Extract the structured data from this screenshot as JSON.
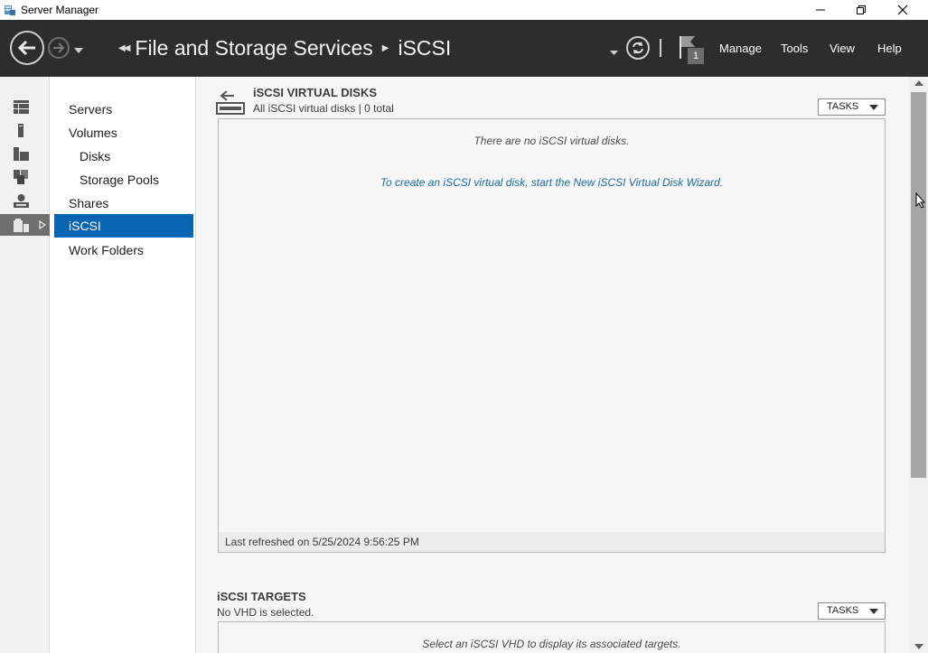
{
  "window": {
    "title": "Server Manager",
    "icon": "server-manager-icon",
    "controls": [
      "minimize-icon",
      "restore-icon",
      "close-icon"
    ]
  },
  "header": {
    "breadcrumb": [
      "File and Storage Services",
      "iSCSI"
    ],
    "notification_count": "1",
    "menu": {
      "manage": "Manage",
      "tools": "Tools",
      "view": "View",
      "help": "Help"
    }
  },
  "icon_strip": [
    "dashboard-icon",
    "local-server-icon",
    "all-servers-icon",
    "file-storage-group-icon",
    "remote-access-icon",
    "file-storage-services-icon"
  ],
  "nav": {
    "servers": "Servers",
    "volumes": "Volumes",
    "disks": "Disks",
    "storage_pools": "Storage Pools",
    "shares": "Shares",
    "iscsi": "iSCSI",
    "work_folders": "Work Folders"
  },
  "virtual_disks": {
    "title": "iSCSI VIRTUAL DISKS",
    "subtitle": "All iSCSI virtual disks | 0 total",
    "tasks": "TASKS",
    "empty": "There are no iSCSI virtual disks.",
    "wizard_link": "To create an iSCSI virtual disk, start the New iSCSI Virtual Disk Wizard.",
    "last_refreshed": "Last refreshed on 5/25/2024 9:56:25 PM"
  },
  "targets": {
    "title": "iSCSI TARGETS",
    "subtitle": "No VHD is selected.",
    "tasks": "TASKS",
    "empty": "Select an iSCSI VHD to display its associated targets."
  },
  "colors": {
    "header_bg": "#2d2d2d",
    "selected_nav": "#0a64b4",
    "link": "#1f6b9e",
    "content_bg": "#f6f6f6"
  }
}
